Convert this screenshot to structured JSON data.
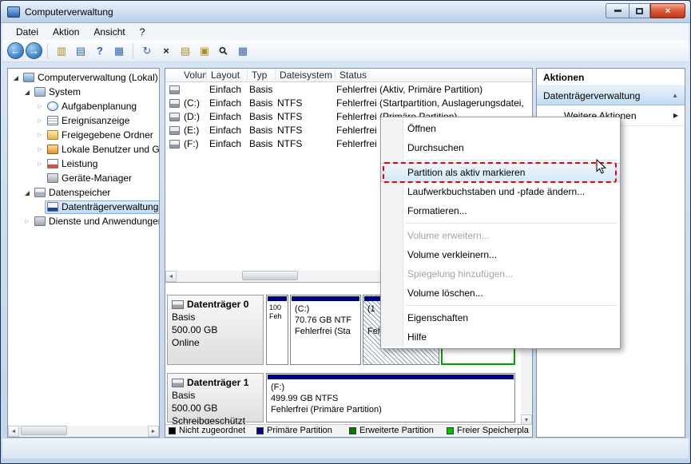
{
  "window": {
    "title": "Computerverwaltung"
  },
  "menubar": {
    "items": [
      "Datei",
      "Aktion",
      "Ansicht",
      "?"
    ]
  },
  "glyphs": {
    "back": "←",
    "forward": "→",
    "show_tree": "▥",
    "export_list": "▤",
    "help": "?",
    "views": "▦",
    "refresh": "↻",
    "delete": "×",
    "properties": "▤",
    "open": "▣",
    "find": "⚲",
    "filter": "▦",
    "expand_collapsed": "▷",
    "expand_expanded": "◢",
    "scroll_left": "◄",
    "scroll_right": "►",
    "scroll_up": "▲",
    "scroll_down": "▼",
    "chevron_up": "▲",
    "submenu_arrow": "▶",
    "close": "×"
  },
  "tree": {
    "items": [
      {
        "label": "Computerverwaltung (Lokal)"
      },
      {
        "label": "System"
      },
      {
        "label": "Aufgabenplanung"
      },
      {
        "label": "Ereignisanzeige"
      },
      {
        "label": "Freigegebene Ordner"
      },
      {
        "label": "Lokale Benutzer und Gru"
      },
      {
        "label": "Leistung"
      },
      {
        "label": "Geräte-Manager"
      },
      {
        "label": "Datenspeicher"
      },
      {
        "label": "Datenträgerverwaltung"
      },
      {
        "label": "Dienste und Anwendungen"
      }
    ]
  },
  "volume_list": {
    "columns": [
      "Volume",
      "Layout",
      "Typ",
      "Dateisystem",
      "Status"
    ],
    "rows": [
      {
        "volume": "",
        "layout": "Einfach",
        "typ": "Basis",
        "fs": "",
        "status": "Fehlerfrei (Aktiv, Primäre Partition)"
      },
      {
        "volume": "(C:)",
        "layout": "Einfach",
        "typ": "Basis",
        "fs": "NTFS",
        "status": "Fehlerfrei (Startpartition, Auslagerungsdatei,"
      },
      {
        "volume": "(D:)",
        "layout": "Einfach",
        "typ": "Basis",
        "fs": "NTFS",
        "status": "Fehlerfrei (Primäre Partition)"
      },
      {
        "volume": "(E:)",
        "layout": "Einfach",
        "typ": "Basis",
        "fs": "NTFS",
        "status": "Fehlerfrei"
      },
      {
        "volume": "(F:)",
        "layout": "Einfach",
        "typ": "Basis",
        "fs": "NTFS",
        "status": "Fehlerfrei"
      }
    ]
  },
  "context_menu": {
    "items": [
      {
        "label": "Öffnen"
      },
      {
        "label": "Durchsuchen"
      },
      {
        "label": "Partition als aktiv markieren"
      },
      {
        "label": "Laufwerkbuchstaben und -pfade ändern..."
      },
      {
        "label": "Formatieren..."
      },
      {
        "label": "Volume erweitern..."
      },
      {
        "label": "Volume verkleinern..."
      },
      {
        "label": "Spiegelung hinzufügen..."
      },
      {
        "label": "Volume löschen..."
      },
      {
        "label": "Eigenschaften"
      },
      {
        "label": "Hilfe"
      }
    ]
  },
  "actions_panel": {
    "title": "Aktionen",
    "section_label": "Datenträgerverwaltung",
    "more_label": "Weitere Aktionen"
  },
  "disk_view": {
    "disks": [
      {
        "name": "Datenträger 0",
        "type": "Basis",
        "size": "500.00 GB",
        "state": "Online",
        "partitions": [
          {
            "l1": "100",
            "l2": "Feh",
            "l3": ""
          },
          {
            "l1": "(C:)",
            "l2": "70.76 GB NTF",
            "l3": "Fehlerfrei (Sta"
          },
          {
            "l1": "(1",
            "l2": "",
            "l3": "Feh"
          },
          {
            "l1": "",
            "l2": "",
            "l3": ""
          }
        ]
      },
      {
        "name": "Datenträger 1",
        "type": "Basis",
        "size": "500.00 GB",
        "state": "Schreibgeschützt",
        "partitions": [
          {
            "l1": "(F:)",
            "l2": "499.99 GB NTFS",
            "l3": "Fehlerfrei (Primäre Partition)"
          }
        ]
      }
    ]
  },
  "legend": {
    "items": [
      {
        "label": "Nicht zugeordnet",
        "color": "#000000",
        "sq": "background:#000000"
      },
      {
        "label": "Primäre Partition",
        "color": "#000080",
        "sq": "background:#000080"
      },
      {
        "label": "Erweiterte Partition",
        "color": "#007a00",
        "sq": "background:#007a00"
      },
      {
        "label": "Freier Speicherpla",
        "color": "#00c000",
        "sq": "background:#00c000"
      }
    ]
  },
  "colors": {
    "primary_partition_stripe": "#000080",
    "extended_partition_border": "#00a000",
    "menu_highlight_marker": "#f20000"
  }
}
